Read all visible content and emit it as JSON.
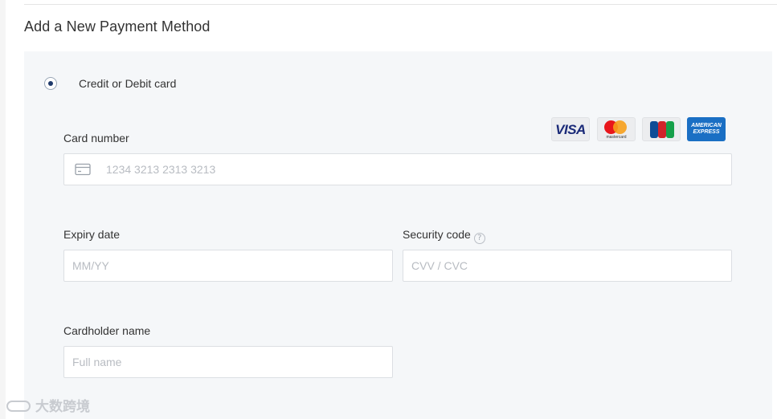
{
  "section_title": "Add a New Payment Method",
  "payment_option": {
    "label": "Credit or Debit card",
    "selected": true
  },
  "card_brands": {
    "visa": "VISA",
    "mastercard": "mastercard",
    "jcb": "JCB",
    "amex_line1": "AMERICAN",
    "amex_line2": "EXPRESS"
  },
  "fields": {
    "card_number": {
      "label": "Card number",
      "placeholder": "1234 3213 2313 3213",
      "value": ""
    },
    "expiry": {
      "label": "Expiry date",
      "placeholder": "MM/YY",
      "value": ""
    },
    "security": {
      "label": "Security code",
      "placeholder": "CVV / CVC",
      "value": "",
      "help": "?"
    },
    "cardholder": {
      "label": "Cardholder name",
      "placeholder": "Full name",
      "value": ""
    }
  },
  "watermark": {
    "text": "大数跨境"
  },
  "colors": {
    "panel_bg": "#f5f7f9",
    "radio_dot": "#1f3a6b",
    "input_border": "#dcdfe3",
    "placeholder": "#b8bcc2",
    "amex_blue": "#1a6fc4"
  }
}
